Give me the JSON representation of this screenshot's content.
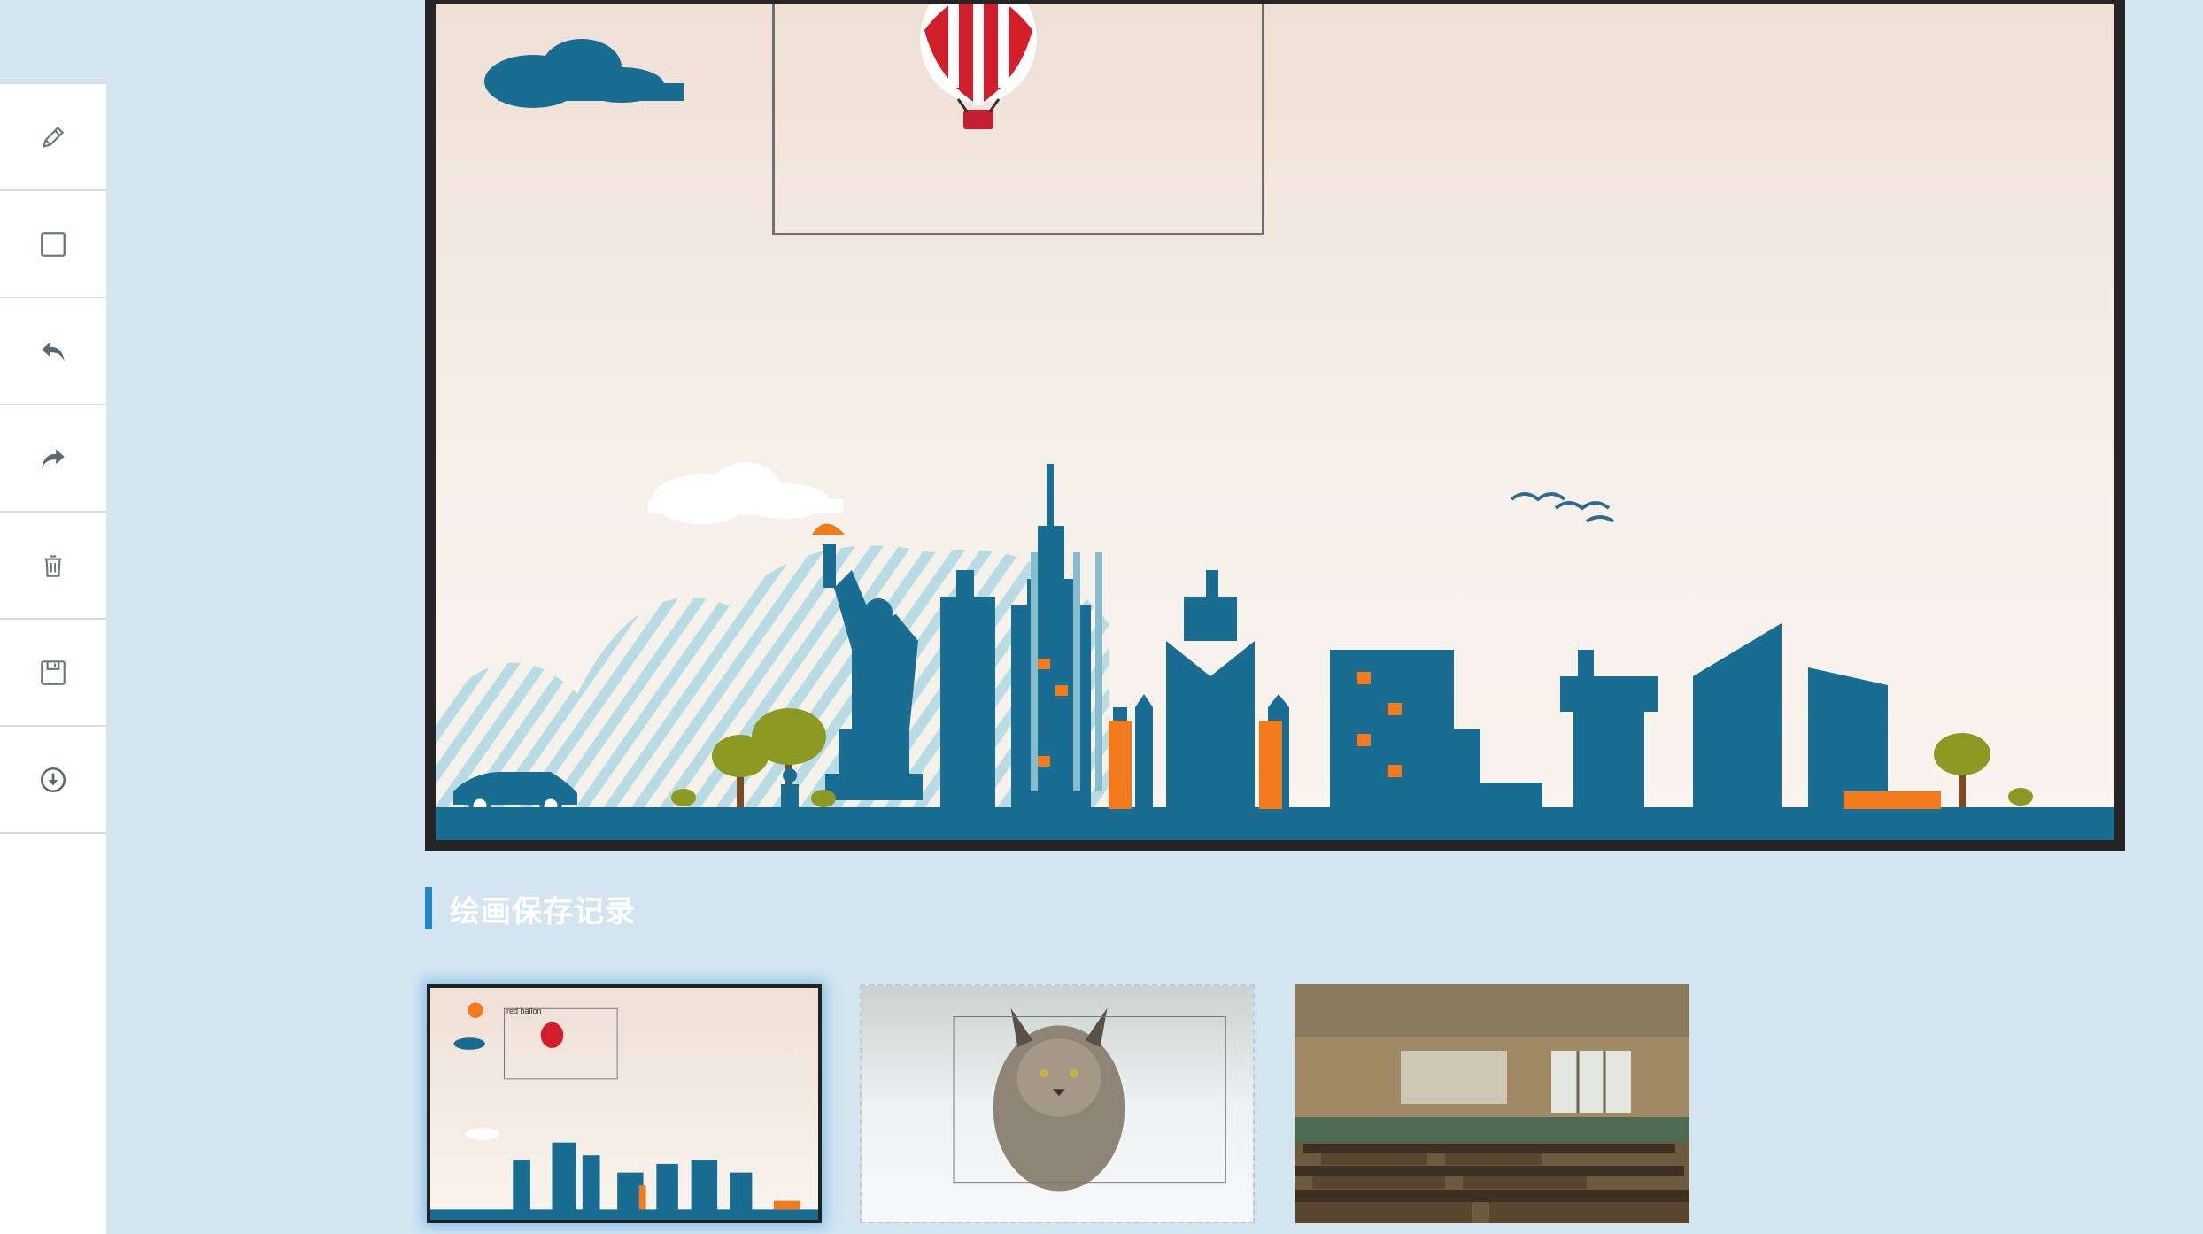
{
  "toolbar": {
    "tools": [
      {
        "name": "pencil-icon"
      },
      {
        "name": "rectangle-icon"
      },
      {
        "name": "undo-icon"
      },
      {
        "name": "redo-icon"
      },
      {
        "name": "trash-icon"
      },
      {
        "name": "save-icon"
      },
      {
        "name": "download-icon"
      }
    ]
  },
  "history": {
    "title": "绘画保存记录",
    "thumbnails": [
      {
        "caption": "red ballon",
        "selected": true,
        "subject": "city-skyline-drawing"
      },
      {
        "caption": "",
        "selected": false,
        "subject": "lynx-photo"
      },
      {
        "caption": "",
        "selected": false,
        "subject": "classroom-photo"
      }
    ]
  },
  "colors": {
    "background": "#d3e5f1",
    "accent": "#1f8ac7",
    "building_blue": "#1a6d92",
    "building_orange": "#f07a1c",
    "frame": "#252525"
  }
}
